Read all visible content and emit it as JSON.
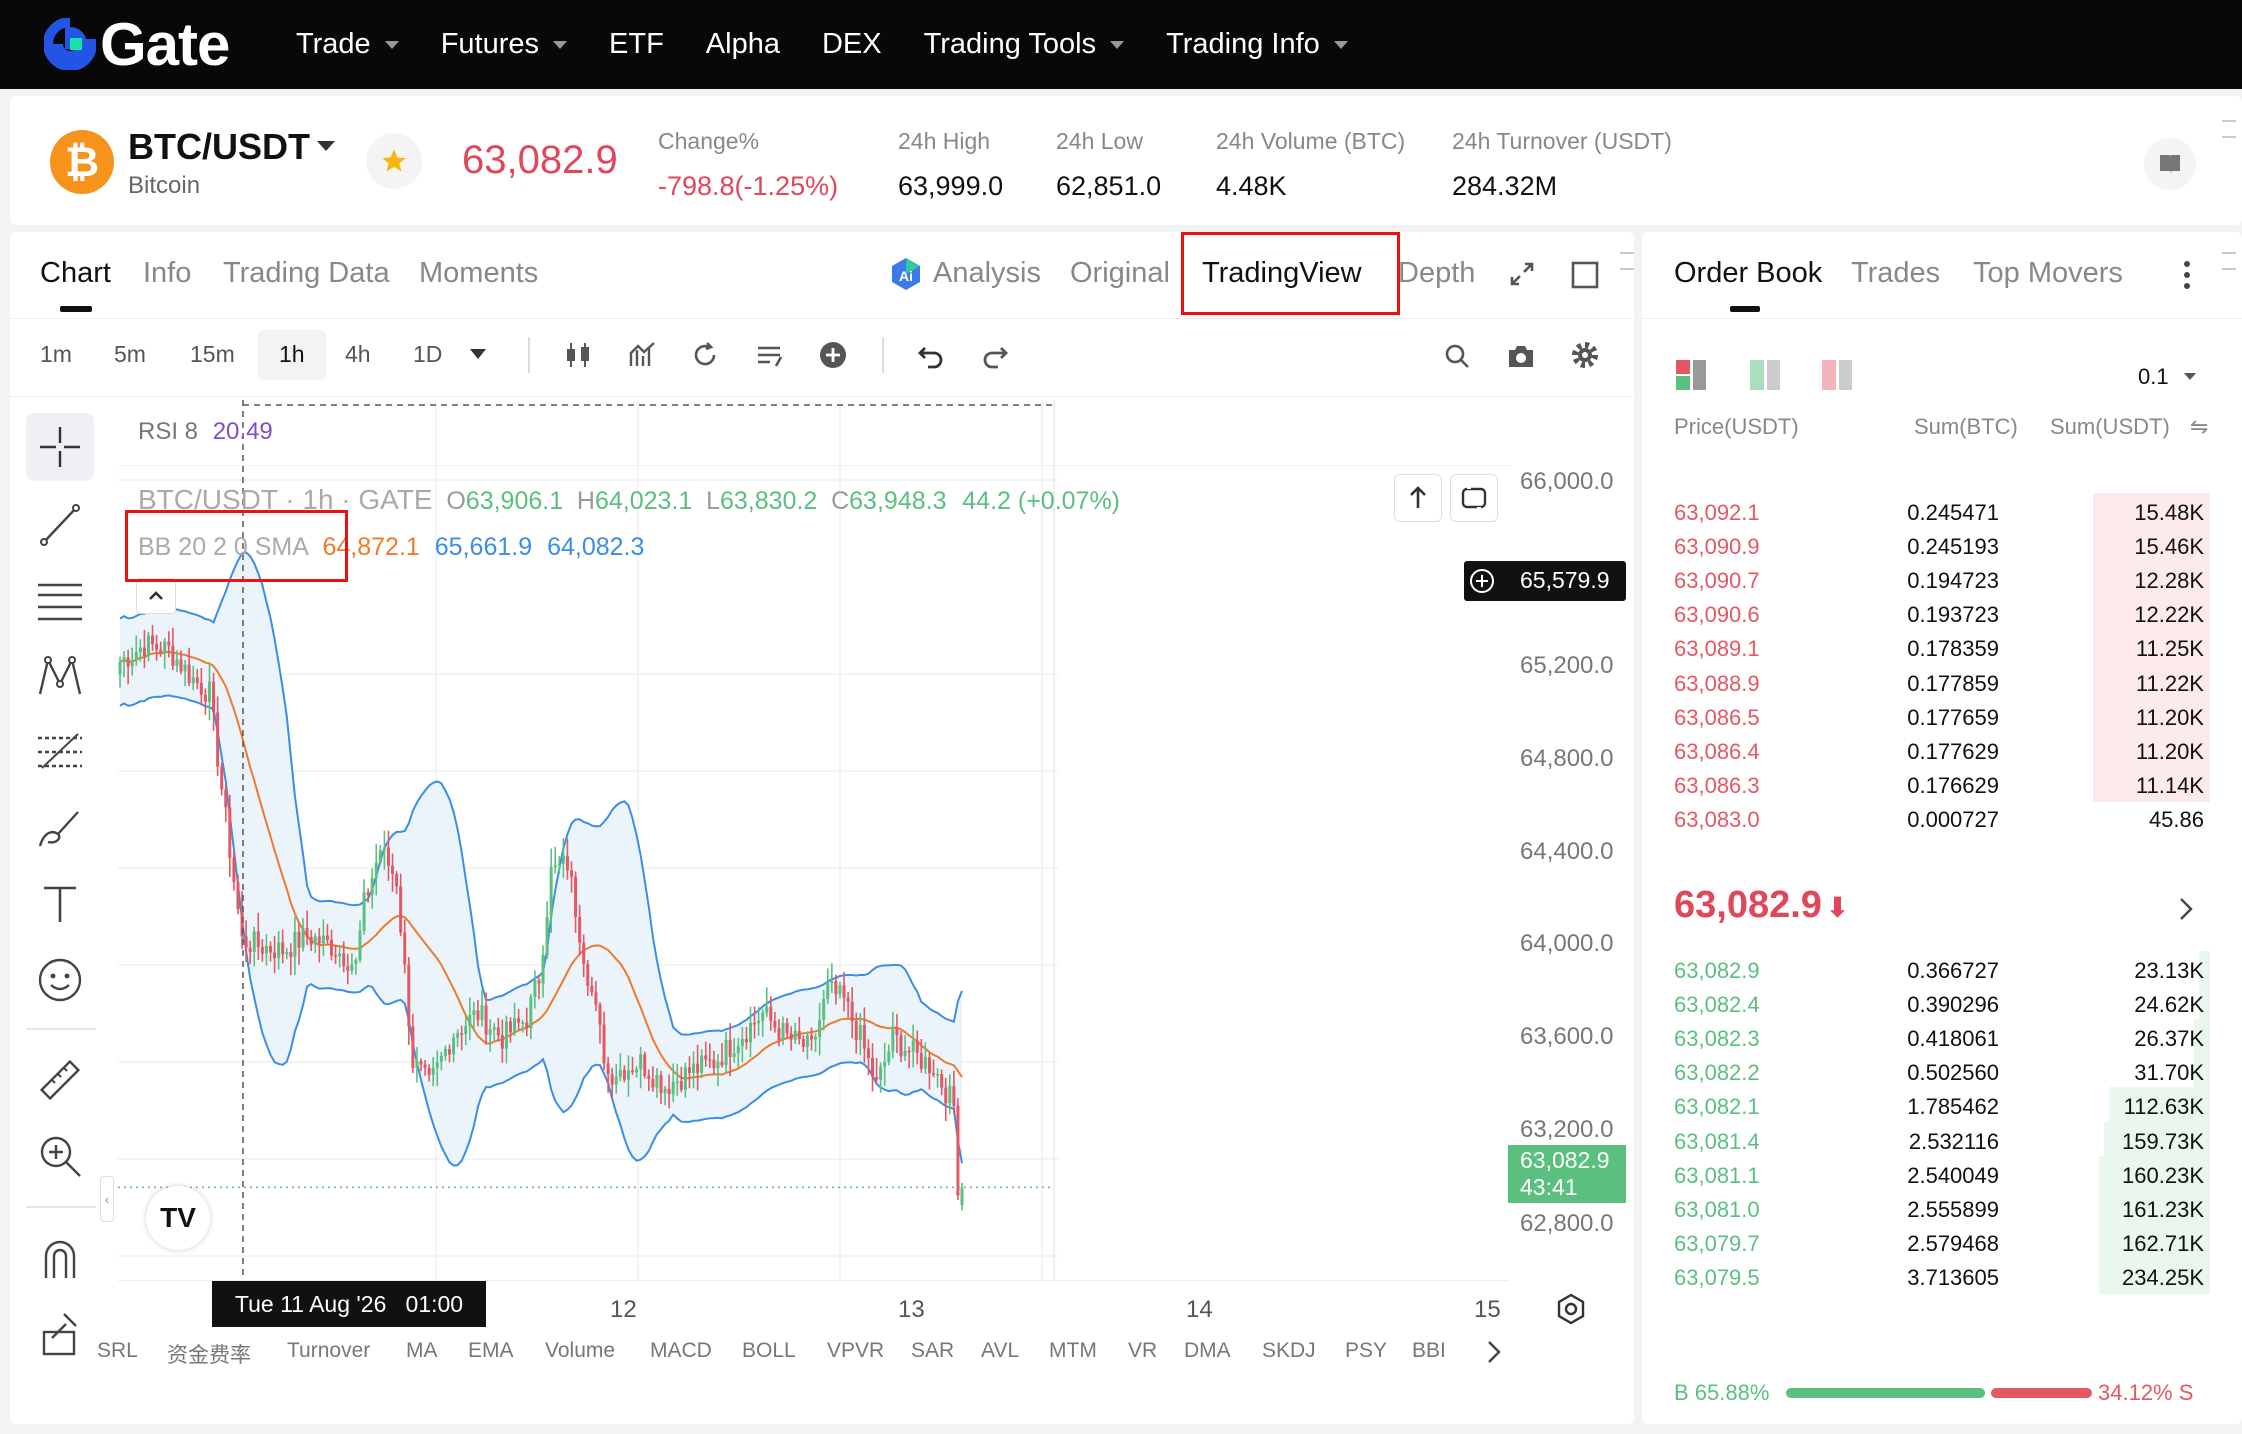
{
  "nav": {
    "logo": "Gate",
    "items": [
      "Trade",
      "Futures",
      "ETF",
      "Alpha",
      "DEX",
      "Trading Tools",
      "Trading Info"
    ],
    "has_caret": [
      true,
      true,
      false,
      false,
      false,
      true,
      true
    ]
  },
  "ticker": {
    "coin_icon": "bitcoin-icon",
    "pair": "BTC/USDT",
    "name": "Bitcoin",
    "last_price": "63,082.9",
    "stats": [
      {
        "label": "Change%",
        "value": "-798.8(-1.25%)",
        "color": "#e0475a"
      },
      {
        "label": "24h High",
        "value": "63,999.0"
      },
      {
        "label": "24h Low",
        "value": "62,851.0"
      },
      {
        "label": "24h Volume (BTC)",
        "value": "4.48K"
      },
      {
        "label": "24h Turnover (USDT)",
        "value": "284.32M"
      }
    ]
  },
  "chart_tabs": [
    "Chart",
    "Info",
    "Trading Data",
    "Moments"
  ],
  "chart_tabs_active": "Chart",
  "view_tabs": [
    "Analysis",
    "Original",
    "TradingView",
    "Depth"
  ],
  "view_tabs_active": "TradingView",
  "timeframes": [
    "1m",
    "5m",
    "15m",
    "1h",
    "4h",
    "1D"
  ],
  "timeframe_active": "1h",
  "chart": {
    "rsi_label": "RSI 8",
    "rsi_value": "20.49",
    "symbol_line": "BTC/USDT · 1h · GATE",
    "ohlc": {
      "o": "63,906.1",
      "h": "64,023.1",
      "l": "63,830.2",
      "c": "63,948.3",
      "chg": "44.2 (+0.07%)"
    },
    "bb_label": "BB 20 2 0 SMA",
    "bb_values": [
      "64,872.1",
      "65,661.9",
      "64,082.3"
    ],
    "crosshair_price": "65,579.9",
    "current_price": "63,082.9",
    "countdown": "43:41",
    "crosshair_time": "Tue 11 Aug '26   01:00",
    "y_ticks": [
      "66,000.0",
      "65,200.0",
      "64,800.0",
      "64,400.0",
      "64,000.0",
      "63,600.0",
      "63,200.0",
      "62,800.0"
    ],
    "x_ticks": [
      "12",
      "13",
      "14",
      "15"
    ],
    "colors": {
      "up": "#5bbf7f",
      "down": "#e35863",
      "bb_band": "#3a8ee6",
      "bb_mid": "#f07a2c",
      "fill": "#eaf3fb"
    }
  },
  "chart_data": {
    "type": "candlestick",
    "title": "BTC/USDT · 1h · GATE",
    "xlabel": "",
    "ylabel": "",
    "x_ticks": [
      "12",
      "13",
      "14",
      "15"
    ],
    "ylim": [
      62700,
      66100
    ],
    "grid": true,
    "series": [
      {
        "name": "BTC/USDT",
        "close_start": 65200,
        "close_end": 63082.9
      },
      {
        "name": "BB upper",
        "value": 65661.9
      },
      {
        "name": "BB basis",
        "value": 64872.1
      },
      {
        "name": "BB lower",
        "value": 64082.3
      }
    ]
  },
  "indicators": [
    "SRL",
    "资金费率",
    "Turnover",
    "MA",
    "EMA",
    "Volume",
    "MACD",
    "BOLL",
    "VPVR",
    "SAR",
    "AVL",
    "MTM",
    "VR",
    "DMA",
    "SKDJ",
    "PSY",
    "BBI"
  ],
  "orderbook": {
    "tabs": [
      "Order Book",
      "Trades",
      "Top Movers"
    ],
    "tabs_active": "Order Book",
    "precision": "0.1",
    "headers": [
      "Price(USDT)",
      "Sum(BTC)",
      "Sum(USDT)"
    ],
    "asks": [
      [
        "63,092.1",
        "0.245471",
        "15.48K",
        0.22
      ],
      [
        "63,090.9",
        "0.245193",
        "15.46K",
        0.22
      ],
      [
        "63,090.7",
        "0.194723",
        "12.28K",
        0.22
      ],
      [
        "63,090.6",
        "0.193723",
        "12.22K",
        0.22
      ],
      [
        "63,089.1",
        "0.178359",
        "11.25K",
        0.22
      ],
      [
        "63,088.9",
        "0.177859",
        "11.22K",
        0.22
      ],
      [
        "63,086.5",
        "0.177659",
        "11.20K",
        0.22
      ],
      [
        "63,086.4",
        "0.177629",
        "11.20K",
        0.22
      ],
      [
        "63,086.3",
        "0.176629",
        "11.14K",
        0.22
      ],
      [
        "63,083.0",
        "0.000727",
        "45.86",
        0.0
      ]
    ],
    "mid_price": "63,082.9",
    "bids": [
      [
        "63,082.9",
        "0.366727",
        "23.13K",
        0.02
      ],
      [
        "63,082.4",
        "0.390296",
        "24.62K",
        0.02
      ],
      [
        "63,082.3",
        "0.418061",
        "26.37K",
        0.03
      ],
      [
        "63,082.2",
        "0.502560",
        "31.70K",
        0.03
      ],
      [
        "63,082.1",
        "1.785462",
        "112.63K",
        0.19
      ],
      [
        "63,081.4",
        "2.532116",
        "159.73K",
        0.2
      ],
      [
        "63,081.1",
        "2.540049",
        "160.23K",
        0.21
      ],
      [
        "63,081.0",
        "2.555899",
        "161.23K",
        0.21
      ],
      [
        "63,079.7",
        "2.579468",
        "162.71K",
        0.21
      ],
      [
        "63,079.5",
        "3.713605",
        "234.25K",
        0.21
      ]
    ],
    "buy_ratio": "B 65.88%",
    "sell_ratio": "34.12% S",
    "buy_fraction": 0.6588
  }
}
